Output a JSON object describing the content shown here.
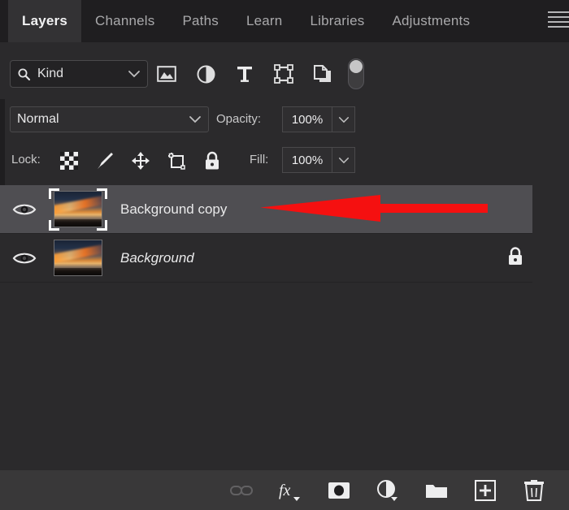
{
  "app": {
    "panel_title": "Layers"
  },
  "tabs": [
    {
      "label": "Layers",
      "active": true
    },
    {
      "label": "Channels",
      "active": false
    },
    {
      "label": "Paths",
      "active": false
    },
    {
      "label": "Learn",
      "active": false
    },
    {
      "label": "Libraries",
      "active": false
    },
    {
      "label": "Adjustments",
      "active": false
    }
  ],
  "menu": {
    "icon": "hamburger-menu-icon"
  },
  "filter": {
    "kind_label": "Kind",
    "search_icon": "search-icon",
    "dropdown_icon": "chevron-down-icon",
    "icons": [
      {
        "name": "filter-pixel-layers-icon",
        "title": "Filter for pixel layers"
      },
      {
        "name": "filter-adjustment-layers-icon",
        "title": "Filter for adjustment layers"
      },
      {
        "name": "filter-type-layers-icon",
        "title": "Filter for type layers"
      },
      {
        "name": "filter-shape-layers-icon",
        "title": "Filter for shape layers"
      },
      {
        "name": "filter-smart-objects-icon",
        "title": "Filter for smart objects"
      }
    ],
    "toggle": {
      "name": "filter-enable-toggle",
      "state": "on"
    }
  },
  "blend": {
    "mode": "Normal",
    "mode_dropdown_icon": "chevron-down-icon",
    "opacity_label": "Opacity:",
    "opacity_value": "100%",
    "opacity_stepper_icon": "chevron-down-icon"
  },
  "lock": {
    "label": "Lock:",
    "fill_label": "Fill:",
    "fill_value": "100%",
    "fill_stepper_icon": "chevron-down-icon",
    "icons": [
      {
        "name": "lock-transparent-pixels-icon",
        "title": "Lock transparent pixels"
      },
      {
        "name": "lock-image-pixels-icon",
        "title": "Lock image pixels"
      },
      {
        "name": "lock-position-icon",
        "title": "Lock position"
      },
      {
        "name": "lock-artboard-nesting-icon",
        "title": "Prevent auto-nesting"
      },
      {
        "name": "lock-all-icon",
        "title": "Lock all"
      }
    ]
  },
  "layers": [
    {
      "name": "Background copy",
      "selected": true,
      "visible": true,
      "italic": false,
      "locked": false,
      "thumbnail": "sunset-sky-photo-thumbnail"
    },
    {
      "name": "Background",
      "selected": false,
      "visible": true,
      "italic": true,
      "locked": true,
      "thumbnail": "sunset-sky-photo-thumbnail"
    }
  ],
  "annotation": {
    "type": "arrow",
    "direction": "left",
    "color": "#f51010",
    "points_at": "Background copy"
  },
  "bottom_toolbar": [
    {
      "name": "link-layers-button",
      "label": "Link layers",
      "disabled": true
    },
    {
      "name": "layer-style-fx-button",
      "label": "fx",
      "disabled": false
    },
    {
      "name": "add-layer-mask-button",
      "label": "Add layer mask",
      "disabled": false
    },
    {
      "name": "new-adjustment-layer-button",
      "label": "New fill or adjustment layer",
      "disabled": false
    },
    {
      "name": "new-group-button",
      "label": "Create a new group",
      "disabled": false
    },
    {
      "name": "new-layer-button",
      "label": "Create a new layer",
      "disabled": false
    },
    {
      "name": "delete-layer-button",
      "label": "Delete layer",
      "disabled": false
    }
  ],
  "colors": {
    "panel_bg": "#2b2a2c",
    "tabbar_bg": "#1f1e20",
    "active_tab_bg": "#333234",
    "selected_row_bg": "#4f4e52",
    "bottom_bar_bg": "#393839",
    "accent_red": "#f51010",
    "text_primary": "#e9e9ea",
    "text_muted": "#a9a9ab"
  }
}
